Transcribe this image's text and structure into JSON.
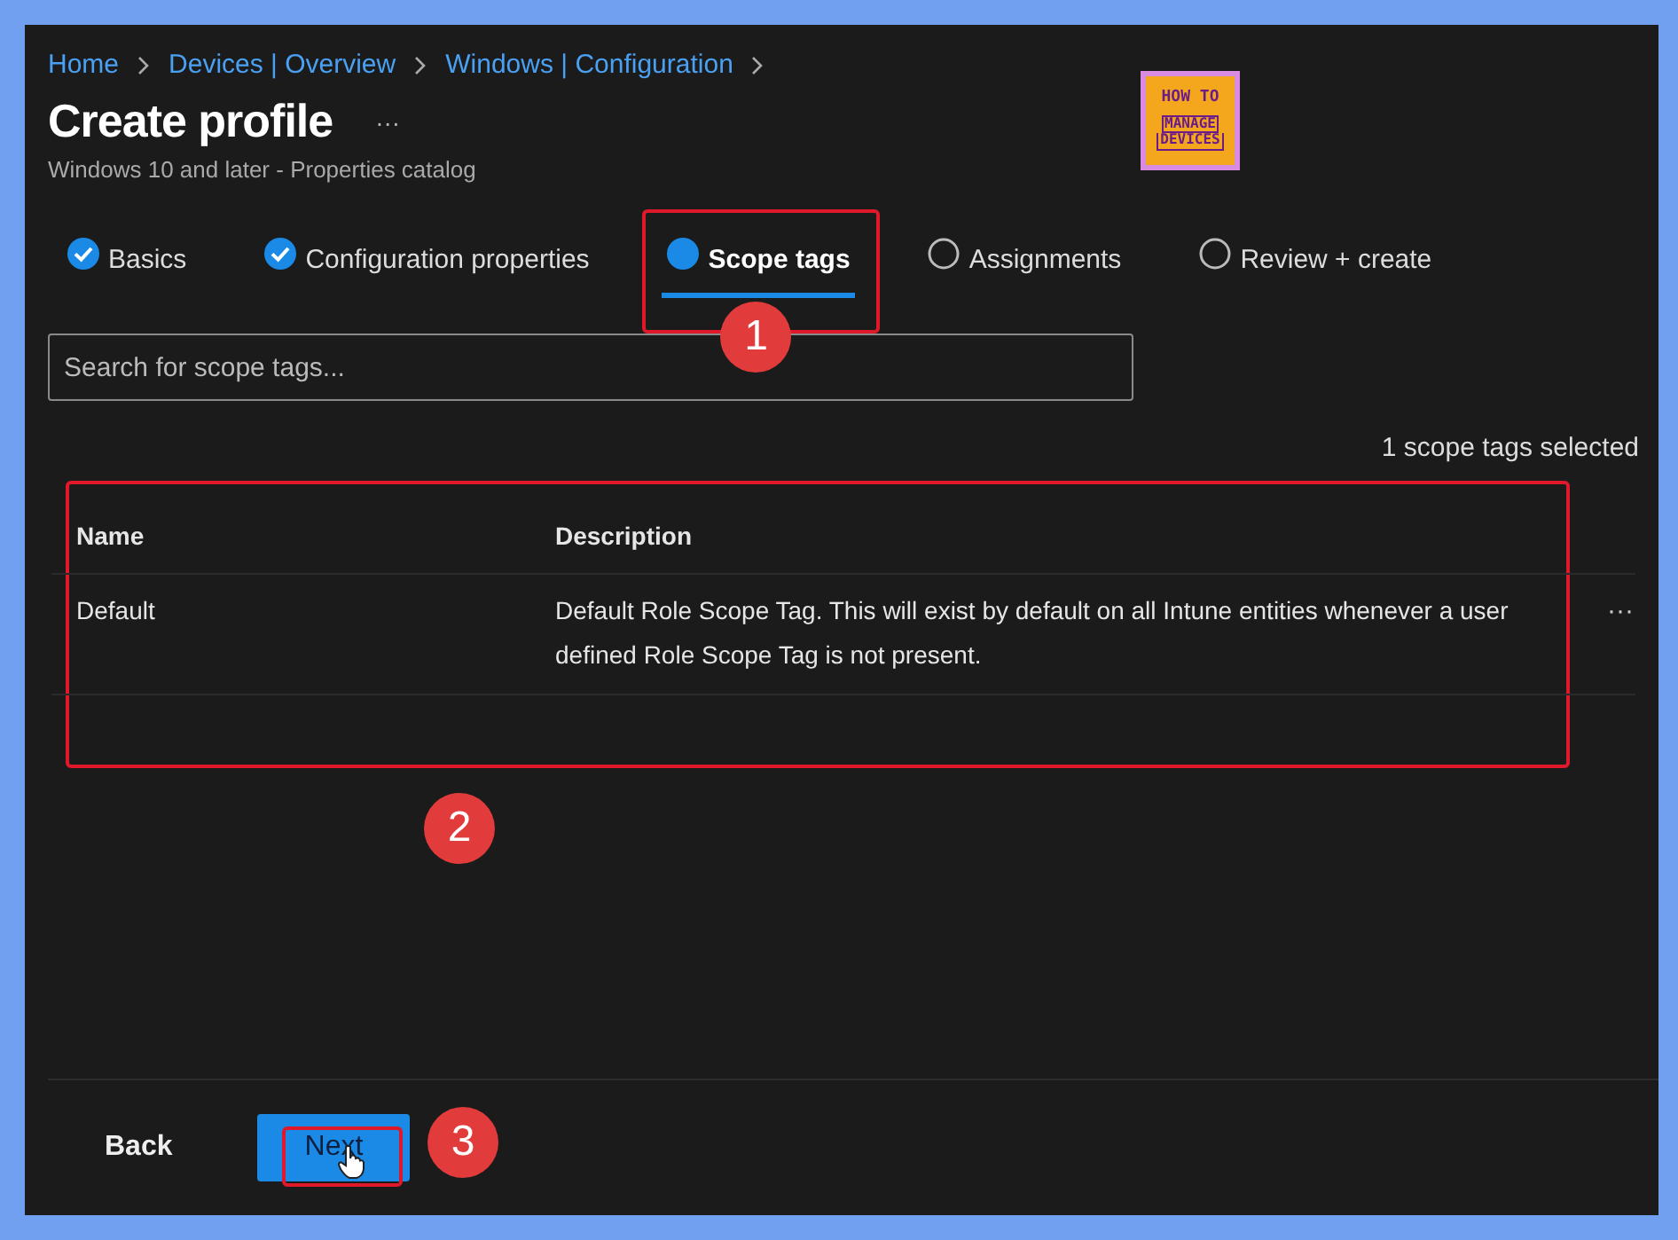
{
  "breadcrumb": [
    "Home",
    "Devices | Overview",
    "Windows | Configuration"
  ],
  "title": "Create profile",
  "more": "···",
  "subtitle": "Windows 10 and later - Properties catalog",
  "logo": {
    "top": "HOW TO",
    "middle": "MANAGE",
    "bottom": "DEVICES"
  },
  "tabs": [
    {
      "label": "Basics",
      "kind": "done",
      "selected": false
    },
    {
      "label": "Configuration properties",
      "kind": "done",
      "selected": false
    },
    {
      "label": "Scope tags",
      "kind": "current",
      "selected": true
    },
    {
      "label": "Assignments",
      "kind": "todo",
      "selected": false
    },
    {
      "label": "Review + create",
      "kind": "todo",
      "selected": false
    }
  ],
  "search": {
    "placeholder": "Search for scope tags..."
  },
  "selection_count": "1 scope tags selected",
  "table": {
    "columns": [
      "Name",
      "Description"
    ],
    "rows": [
      {
        "name": "Default",
        "description": "Default Role Scope Tag. This will exist by default on all Intune entities whenever a user defined Role Scope Tag is not present.",
        "more": "···"
      }
    ]
  },
  "buttons": {
    "back": "Back",
    "next": "Next"
  },
  "callouts": [
    "1",
    "2",
    "3"
  ]
}
